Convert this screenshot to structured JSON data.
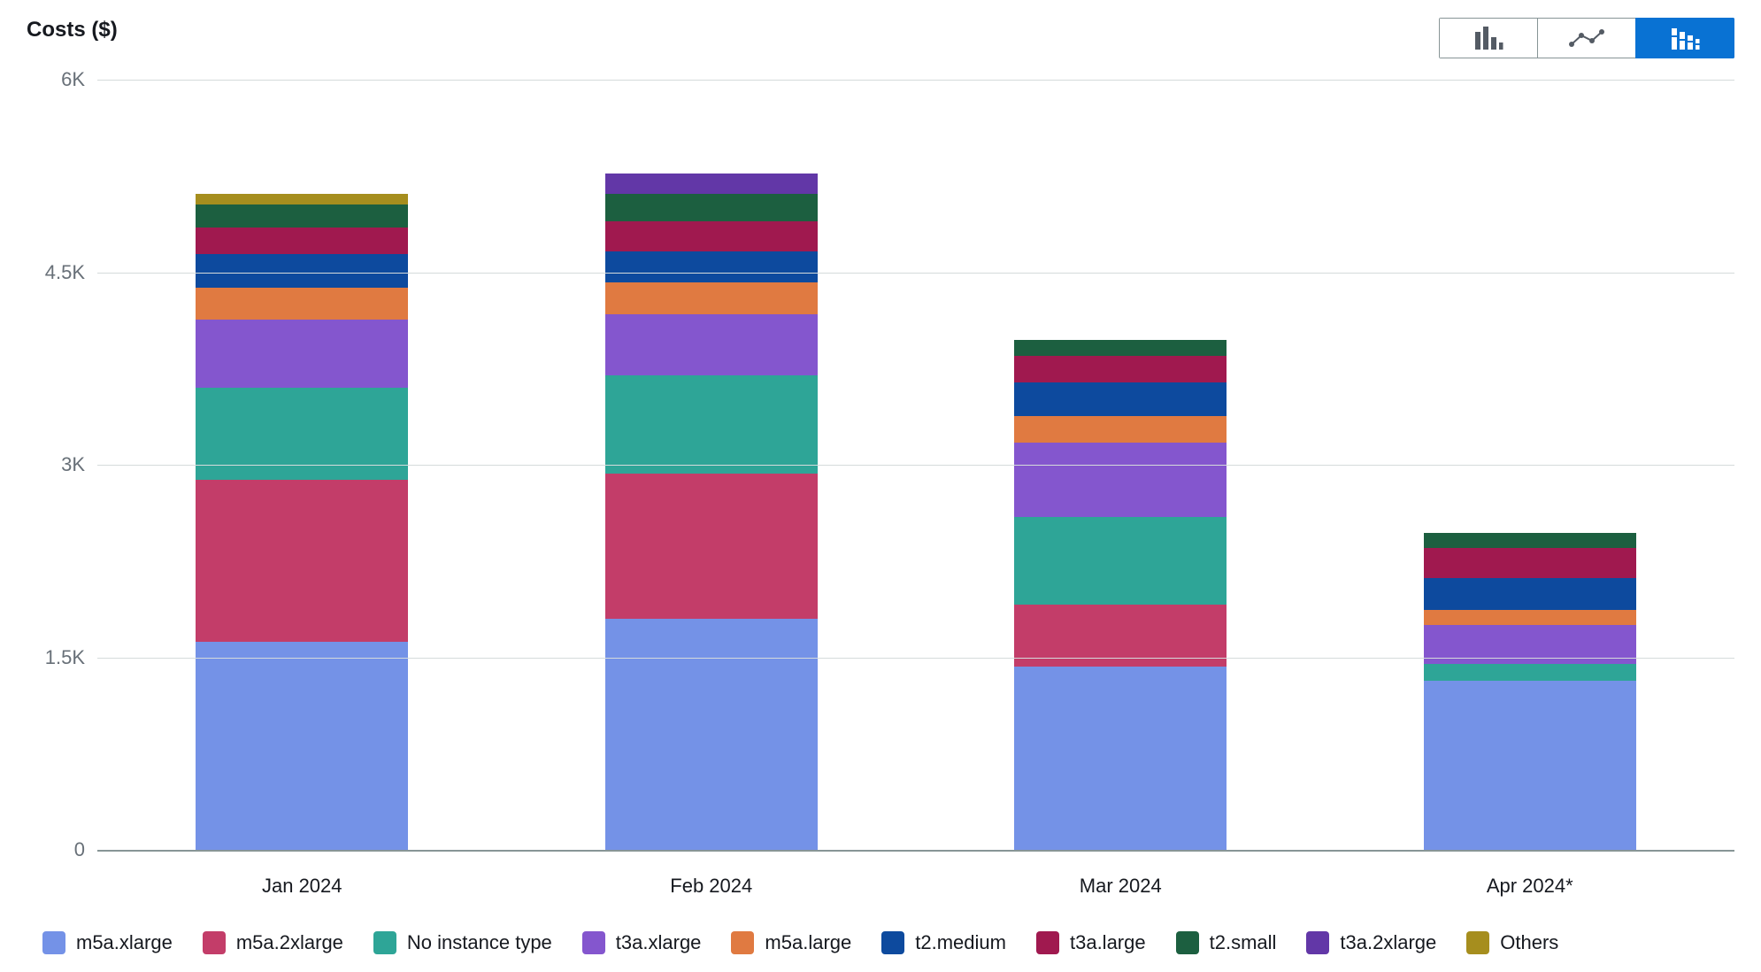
{
  "title": "Costs ($)",
  "toggle": {
    "options": [
      "bar",
      "line",
      "stacked"
    ],
    "selected": "stacked"
  },
  "chart_data": {
    "type": "bar",
    "stacked": true,
    "title": "Costs ($)",
    "xlabel": "",
    "ylabel": "",
    "ylim": [
      0,
      6000
    ],
    "y_ticks": [
      0,
      1500,
      3000,
      4500,
      6000
    ],
    "y_tick_labels": [
      "0",
      "1.5K",
      "3K",
      "4.5K",
      "6K"
    ],
    "categories": [
      "Jan 2024",
      "Feb 2024",
      "Mar 2024",
      "Apr 2024*"
    ],
    "series": [
      {
        "name": "m5a.xlarge",
        "color": "#7492e7",
        "values": [
          1620,
          1800,
          1430,
          1320
        ]
      },
      {
        "name": "m5a.2xlarge",
        "color": "#c33d69",
        "values": [
          1260,
          1130,
          480,
          0
        ]
      },
      {
        "name": "No instance type",
        "color": "#2ea597",
        "values": [
          720,
          770,
          680,
          130
        ]
      },
      {
        "name": "t3a.xlarge",
        "color": "#8456ce",
        "values": [
          530,
          470,
          580,
          300
        ]
      },
      {
        "name": "m5a.large",
        "color": "#e07a41",
        "values": [
          250,
          250,
          210,
          120
        ]
      },
      {
        "name": "t2.medium",
        "color": "#0d4a9e",
        "values": [
          260,
          240,
          260,
          250
        ]
      },
      {
        "name": "t3a.large",
        "color": "#a0194f",
        "values": [
          210,
          240,
          210,
          230
        ]
      },
      {
        "name": "t2.small",
        "color": "#1c5f40",
        "values": [
          180,
          210,
          120,
          120
        ]
      },
      {
        "name": "t3a.2xlarge",
        "color": "#6237a7",
        "values": [
          0,
          160,
          0,
          0
        ]
      },
      {
        "name": "Others",
        "color": "#a68e1e",
        "values": [
          80,
          0,
          0,
          0
        ]
      }
    ]
  }
}
